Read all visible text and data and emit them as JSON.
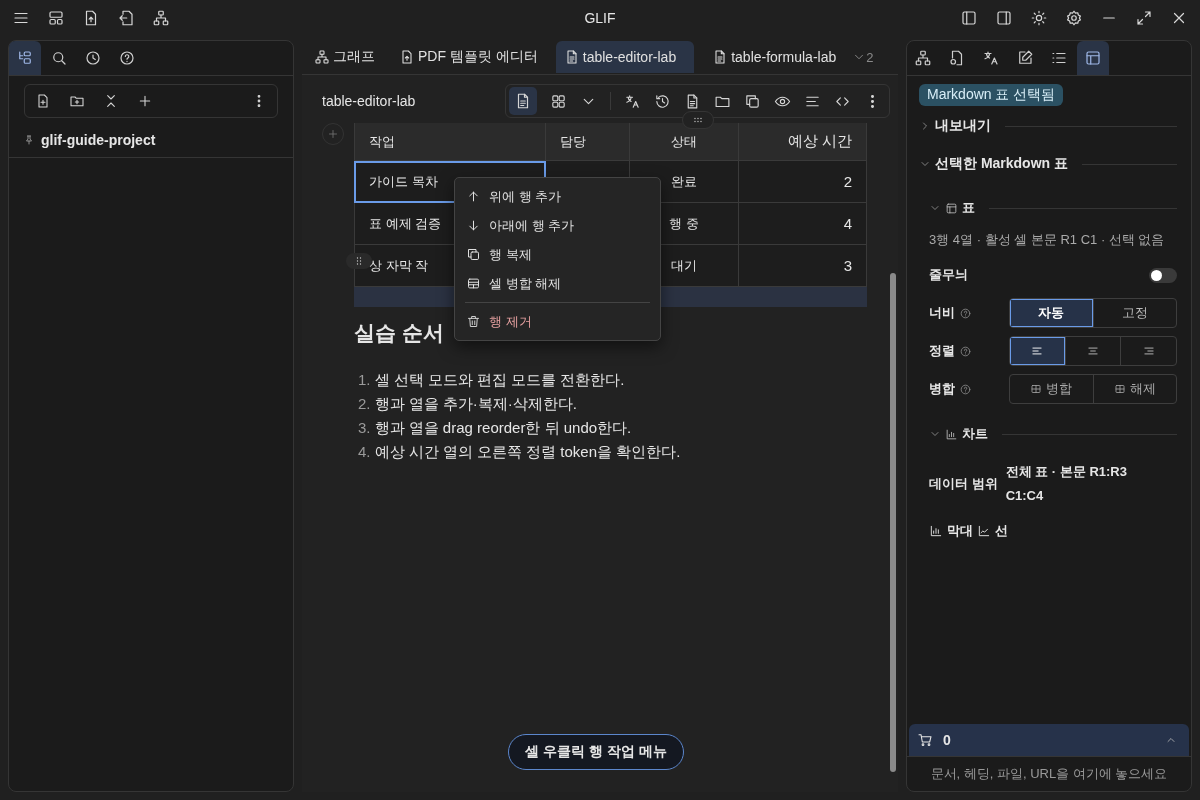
{
  "window": {
    "title": "GLIF"
  },
  "left_panel": {
    "tabs": [
      {
        "selected": true
      },
      {
        "selected": false
      },
      {
        "selected": false
      },
      {
        "selected": false
      }
    ],
    "project": "glif-guide-project"
  },
  "editor_tabs": [
    {
      "label": "그래프",
      "selected": false
    },
    {
      "label": "PDF 템플릿 에디터",
      "selected": false
    },
    {
      "label": "table-editor-lab",
      "selected": true
    },
    {
      "label": "table-formula-lab",
      "selected": false
    }
  ],
  "tab_overflow": "2",
  "document": {
    "title": "table-editor-lab",
    "table": {
      "columns": [
        {
          "label": "작업"
        },
        {
          "label": "담당"
        },
        {
          "label": "상태"
        },
        {
          "label": "예상 시간"
        }
      ],
      "rows": [
        {
          "cells": [
            "가이드 목차",
            "",
            "완료",
            "2"
          ],
          "active": true
        },
        {
          "cells": [
            "표 예제 검증",
            "",
            "행 중",
            "4"
          ],
          "active": false
        },
        {
          "cells": [
            "상 자막 작",
            "",
            "대기",
            "3"
          ],
          "active": false
        }
      ]
    },
    "heading": "실습 순서",
    "steps": [
      {
        "number": "1.",
        "text": "셀 선택 모드와 편집 모드를 전환한다."
      },
      {
        "number": "2.",
        "text": "행과 열을 추가·복제·삭제한다."
      },
      {
        "number": "3.",
        "text": "행과 열을 drag reorder한 뒤 undo한다."
      },
      {
        "number": "4.",
        "text": "예상 시간 열의 오른쪽 정렬 token을 확인한다."
      }
    ]
  },
  "context_menu": [
    {
      "label": "위에 행 추가",
      "kind": "up"
    },
    {
      "label": "아래에 행 추가",
      "kind": "down"
    },
    {
      "label": "행 복제",
      "kind": "copy"
    },
    {
      "label": "셀 병합 해제",
      "kind": "unmerge"
    },
    {
      "label": "행 제거",
      "kind": "delete"
    }
  ],
  "hint": "셀 우클릭 행 작업 메뉴",
  "right_panel": {
    "tabs": [
      {
        "selected": false
      },
      {
        "selected": false
      },
      {
        "selected": false
      },
      {
        "selected": false
      },
      {
        "selected": false
      },
      {
        "selected": true
      }
    ],
    "badge": "Markdown 표 선택됨",
    "sections": [
      {
        "label": "내보내기",
        "expanded": false
      },
      {
        "label": "선택한 Markdown 표",
        "expanded": true
      }
    ],
    "table_group": {
      "label": "표",
      "expanded": true,
      "info": "3행 4열 · 활성 셀 본문 R1 C1 · 선택 없음",
      "stripes": {
        "label": "줄무늬",
        "on": false
      },
      "width": {
        "label": "너비",
        "options": [
          {
            "label": "자동",
            "selected": true
          },
          {
            "label": "고정",
            "selected": false
          }
        ]
      },
      "align": {
        "label": "정렬",
        "options": [
          {
            "kind": "left",
            "selected": true
          },
          {
            "kind": "center",
            "selected": false
          },
          {
            "kind": "right",
            "selected": false
          }
        ]
      },
      "merge": {
        "label": "병합",
        "buttons": [
          "병합",
          "해제"
        ]
      }
    },
    "chart_group": {
      "label": "차트",
      "expanded": true,
      "range_label": "데이터 범위",
      "range": "전체 표 · 본문 R1:R3 C1:C4",
      "types": [
        {
          "label": "막대",
          "kind": "bar"
        },
        {
          "label": "선",
          "kind": "line"
        }
      ]
    },
    "cart": {
      "count": "0",
      "expanded": false
    },
    "drop_hint": "문서, 헤딩, 파일, URL을 여기에 놓으세요"
  }
}
